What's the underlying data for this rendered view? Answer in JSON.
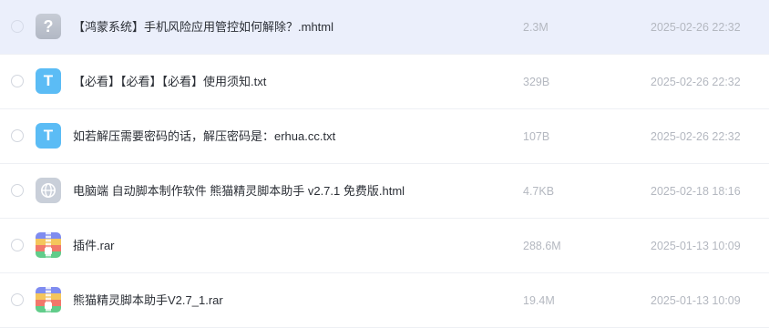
{
  "files": [
    {
      "name": "【鸿蒙系统】手机风险应用管控如何解除？.mhtml",
      "size": "2.3M",
      "date": "2025-02-26 22:32",
      "icon": "unknown-file-icon",
      "icon_glyph": "?",
      "selected": true
    },
    {
      "name": "【必看】【必看】【必看】使用须知.txt",
      "size": "329B",
      "date": "2025-02-26 22:32",
      "icon": "text-file-icon",
      "icon_glyph": "T",
      "selected": false
    },
    {
      "name": "如若解压需要密码的话，解压密码是：erhua.cc.txt",
      "size": "107B",
      "date": "2025-02-26 22:32",
      "icon": "text-file-icon",
      "icon_glyph": "T",
      "selected": false
    },
    {
      "name": "电脑端 自动脚本制作软件 熊猫精灵脚本助手 v2.7.1 免费版.html",
      "size": "4.7KB",
      "date": "2025-02-18 18:16",
      "icon": "web-file-icon",
      "selected": false
    },
    {
      "name": "插件.rar",
      "size": "288.6M",
      "date": "2025-01-13 10:09",
      "icon": "archive-file-icon",
      "selected": false
    },
    {
      "name": "熊猫精灵脚本助手V2.7_1.rar",
      "size": "19.4M",
      "date": "2025-01-13 10:09",
      "icon": "archive-file-icon",
      "selected": false
    }
  ],
  "colors": {
    "selected_row": "#ebeffb",
    "txt_icon": "#5bbcf5",
    "name_text": "#2b2f36",
    "meta_text": "#b4b8c0"
  }
}
